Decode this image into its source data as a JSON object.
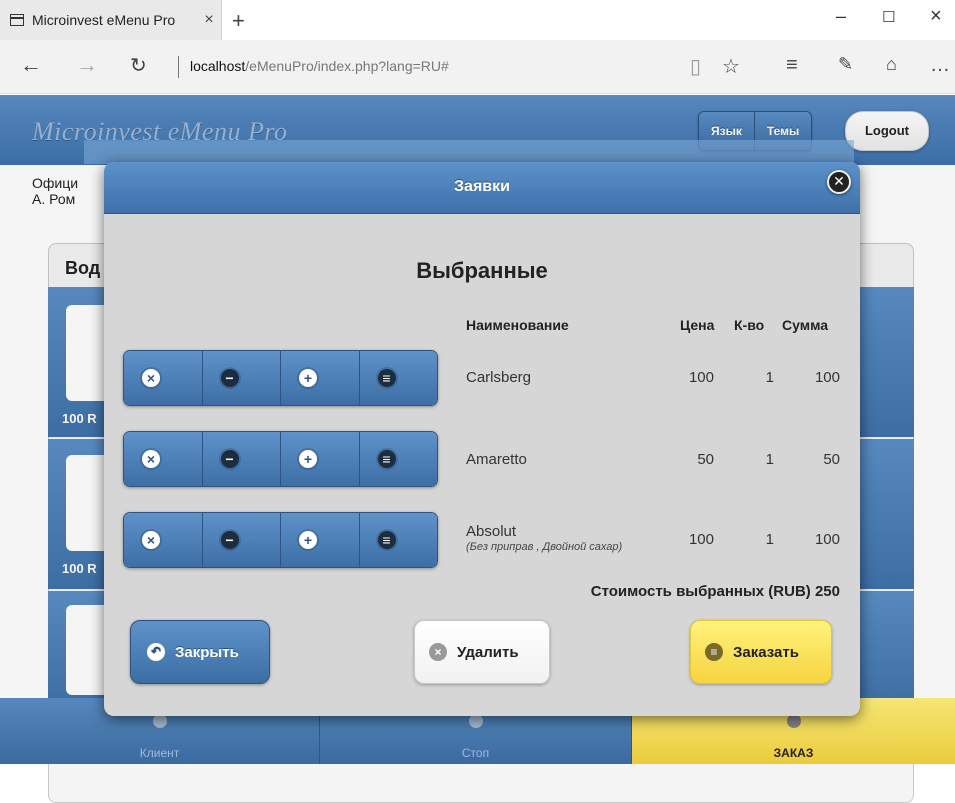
{
  "browser": {
    "tab_title": "Microinvest eMenu Pro",
    "tab_close": "×",
    "new_tab": "+",
    "url_host": "localhost",
    "url_path": "/eMenuPro/index.php?lang=RU#",
    "minimize": "–",
    "maximize": "☐",
    "close": "×"
  },
  "app": {
    "logo": "Microinvest eMenu Pro",
    "language_btn": "Язык",
    "themes_btn": "Темы",
    "logout_btn": "Logout",
    "waiter_line1": "Офици",
    "waiter_line2": "А. Ром",
    "category_title": "Вод",
    "price_1": "100 R",
    "price_2": "100 R",
    "footer": {
      "client": "Клиент",
      "stop": "Стоп",
      "order": "ЗАКАЗ"
    }
  },
  "dialog": {
    "title": "Заявки",
    "close_icon": "✕",
    "heading": "Выбранные",
    "columns": {
      "name": "Наименование",
      "price": "Цена",
      "qty": "К-во",
      "sum": "Сумма"
    },
    "items": [
      {
        "name": "Carlsberg",
        "modifiers": "",
        "price": "100",
        "qty": "1",
        "sum": "100"
      },
      {
        "name": "Amaretto",
        "modifiers": "",
        "price": "50",
        "qty": "1",
        "sum": "50"
      },
      {
        "name": "Absolut",
        "modifiers": "(Без приправ , Двойной сахар)",
        "price": "100",
        "qty": "1",
        "sum": "100"
      }
    ],
    "total": "Стоимость выбранных (RUB) 250",
    "buttons": {
      "close": "Закрыть",
      "delete": "Удалить",
      "order": "Заказать"
    }
  },
  "colors": {
    "header_blue": "#4a7fb9",
    "order_yellow": "#f9e05a",
    "dialog_bg": "#d6d6d6"
  }
}
